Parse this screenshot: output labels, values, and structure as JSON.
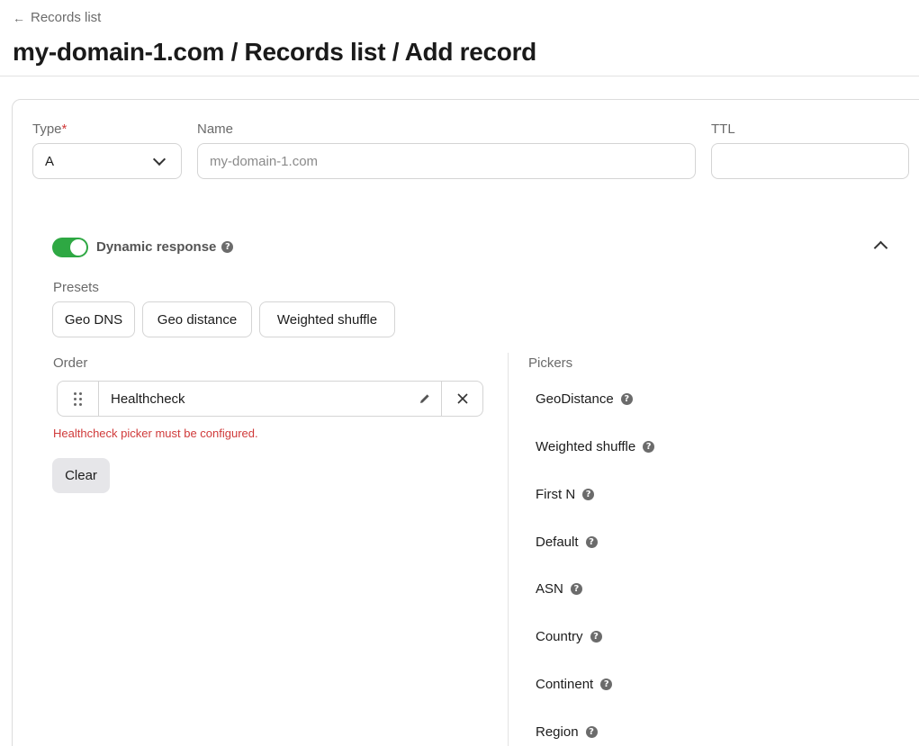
{
  "header": {
    "back_label": "Records list",
    "title": "my-domain-1.com / Records list / Add record"
  },
  "form": {
    "type_label": "Type",
    "type_required_mark": "*",
    "type_value": "A",
    "name_label": "Name",
    "name_placeholder": "my-domain-1.com",
    "ttl_label": "TTL",
    "ttl_value": ""
  },
  "dynamic_response": {
    "label": "Dynamic response",
    "enabled": true,
    "presets_label": "Presets",
    "presets": [
      "Geo DNS",
      "Geo distance",
      "Weighted shuffle"
    ]
  },
  "order": {
    "label": "Order",
    "items": [
      {
        "name": "Healthcheck"
      }
    ],
    "error": "Healthcheck picker must be configured.",
    "clear_label": "Clear"
  },
  "pickers": {
    "label": "Pickers",
    "items": [
      "GeoDistance",
      "Weighted shuffle",
      "First N",
      "Default",
      "ASN",
      "Country",
      "Continent",
      "Region"
    ]
  },
  "colors": {
    "toggle_on": "#2ea843",
    "error": "#d03a3a",
    "required": "#d23b3b"
  }
}
